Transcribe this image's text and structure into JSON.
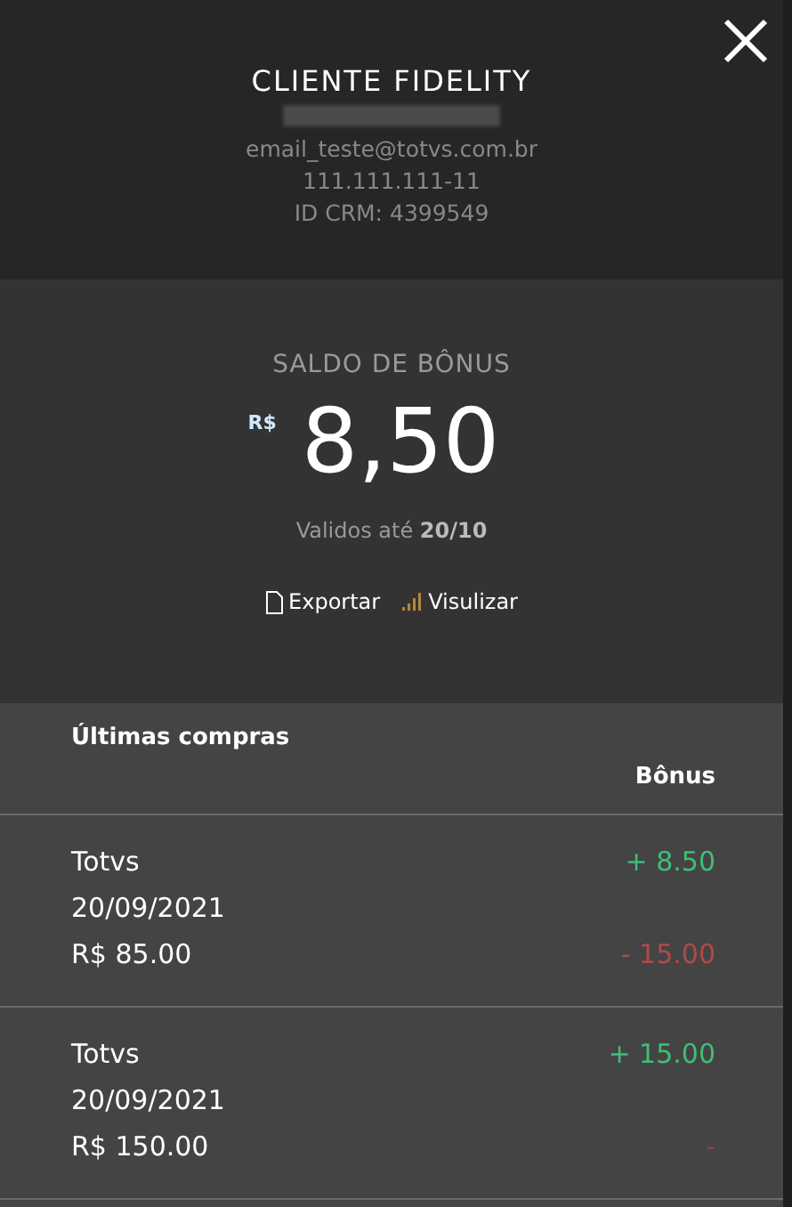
{
  "header": {
    "title": "CLIENTE FIDELITY",
    "name_redacted": true,
    "email": "email_teste@totvs.com.br",
    "document": "111.111.111-11",
    "crm": "ID CRM: 4399549"
  },
  "balance": {
    "label": "SALDO DE BÔNUS",
    "currency": "R$",
    "value": "8,50",
    "validity": "Validos até **20/10**"
  },
  "actions": [
    {
      "kind": "export",
      "label": "Exportar"
    },
    {
      "kind": "view",
      "label": "Visulizar"
    }
  ],
  "purchases": {
    "title": "Últimas compras",
    "bonus_heading": "Bônus",
    "rows": [
      {
        "store": "Totvs",
        "date": "20/09/2021",
        "amount": "R$ 85.00",
        "earned": "+ 8.50",
        "redeemed": "- 15.00"
      },
      {
        "store": "Totvs",
        "date": "20/09/2021",
        "amount": "R$ 150.00",
        "earned": "+ 15.00",
        "redeemed": "-"
      }
    ]
  }
}
